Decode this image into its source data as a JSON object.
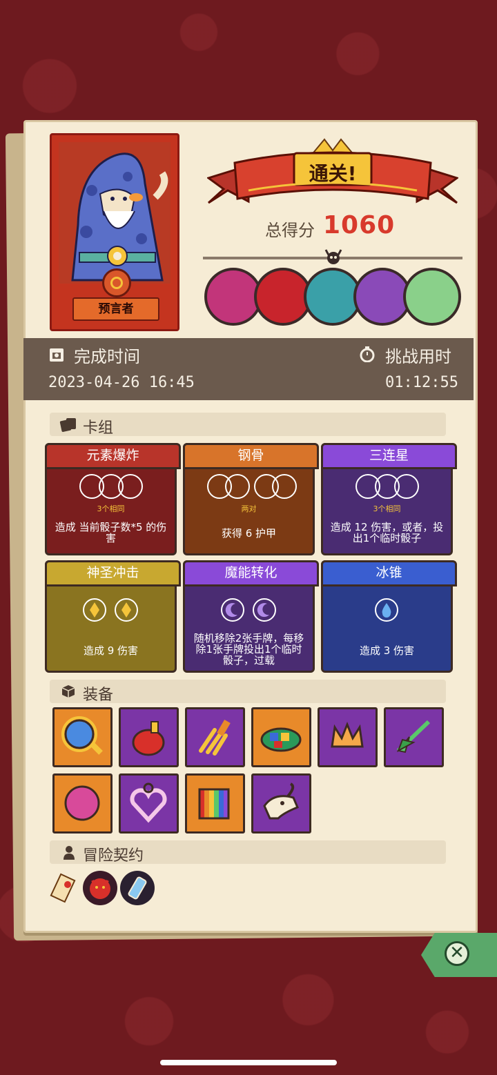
{
  "hero": {
    "name": "预言者"
  },
  "result": {
    "banner": "通关!",
    "score_label": "总得分",
    "score_value": "1060"
  },
  "bosses": [
    {
      "icon": "stone-golem-boss-icon",
      "color": "#c2357a"
    },
    {
      "icon": "red-cage-boss-icon",
      "color": "#c8242c"
    },
    {
      "icon": "armored-knight-boss-icon",
      "color": "#3aa0a8"
    },
    {
      "icon": "purple-dragon-boss-icon",
      "color": "#8a4ab8"
    },
    {
      "icon": "elf-queen-boss-icon",
      "color": "#8ad08a"
    }
  ],
  "info": {
    "complete_label": "完成时间",
    "complete_value": "2023-04-26 16:45",
    "challenge_label": "挑战用时",
    "challenge_value": "01:12:55"
  },
  "deck": {
    "title": "卡组",
    "cards": [
      {
        "name": "元素爆炸",
        "condition": "3个相同",
        "desc": "造成 当前骰子数*5 的伤害",
        "color": "#7a1e1e",
        "head": "#b8342a"
      },
      {
        "name": "钢骨",
        "condition": "两对",
        "desc": "获得 6 护甲",
        "color": "#7c3a14",
        "head": "#d8742a"
      },
      {
        "name": "三连星",
        "condition": "3个相同",
        "desc": "造成 12 伤害，或者，投出1个临时骰子",
        "color": "#4a2c72",
        "head": "#8a4ad8"
      },
      {
        "name": "神圣冲击",
        "condition": "",
        "desc": "造成 9 伤害",
        "color": "#8a7420",
        "head": "#c8a830"
      },
      {
        "name": "魔能转化",
        "condition": "",
        "desc": "随机移除2张手牌，每移除1张手牌投出1个临时骰子，过载",
        "color": "#4a2c72",
        "head": "#8a4ad8"
      },
      {
        "name": "冰锥",
        "condition": "",
        "desc": "造成 3 伤害",
        "color": "#2a3c8a",
        "head": "#3a5ed0"
      }
    ]
  },
  "equipment": {
    "title": "装备",
    "items": [
      {
        "icon": "magic-mirror-icon",
        "color": "orange"
      },
      {
        "icon": "red-potion-icon",
        "color": "purple"
      },
      {
        "icon": "golden-fork-icon",
        "color": "purple"
      },
      {
        "icon": "snake-dice-icon",
        "color": "orange"
      },
      {
        "icon": "crown-icon",
        "color": "purple"
      },
      {
        "icon": "green-dart-icon",
        "color": "purple"
      },
      {
        "icon": "moon-orb-icon",
        "color": "orange"
      },
      {
        "icon": "heart-necklace-icon",
        "color": "purple"
      },
      {
        "icon": "rainbow-book-icon",
        "color": "orange"
      },
      {
        "icon": "dragon-skull-icon",
        "color": "purple"
      }
    ]
  },
  "contracts": {
    "title": "冒险契约",
    "items": [
      {
        "icon": "scroll-icon"
      },
      {
        "icon": "red-demon-icon"
      },
      {
        "icon": "blue-potion-icon"
      }
    ]
  }
}
